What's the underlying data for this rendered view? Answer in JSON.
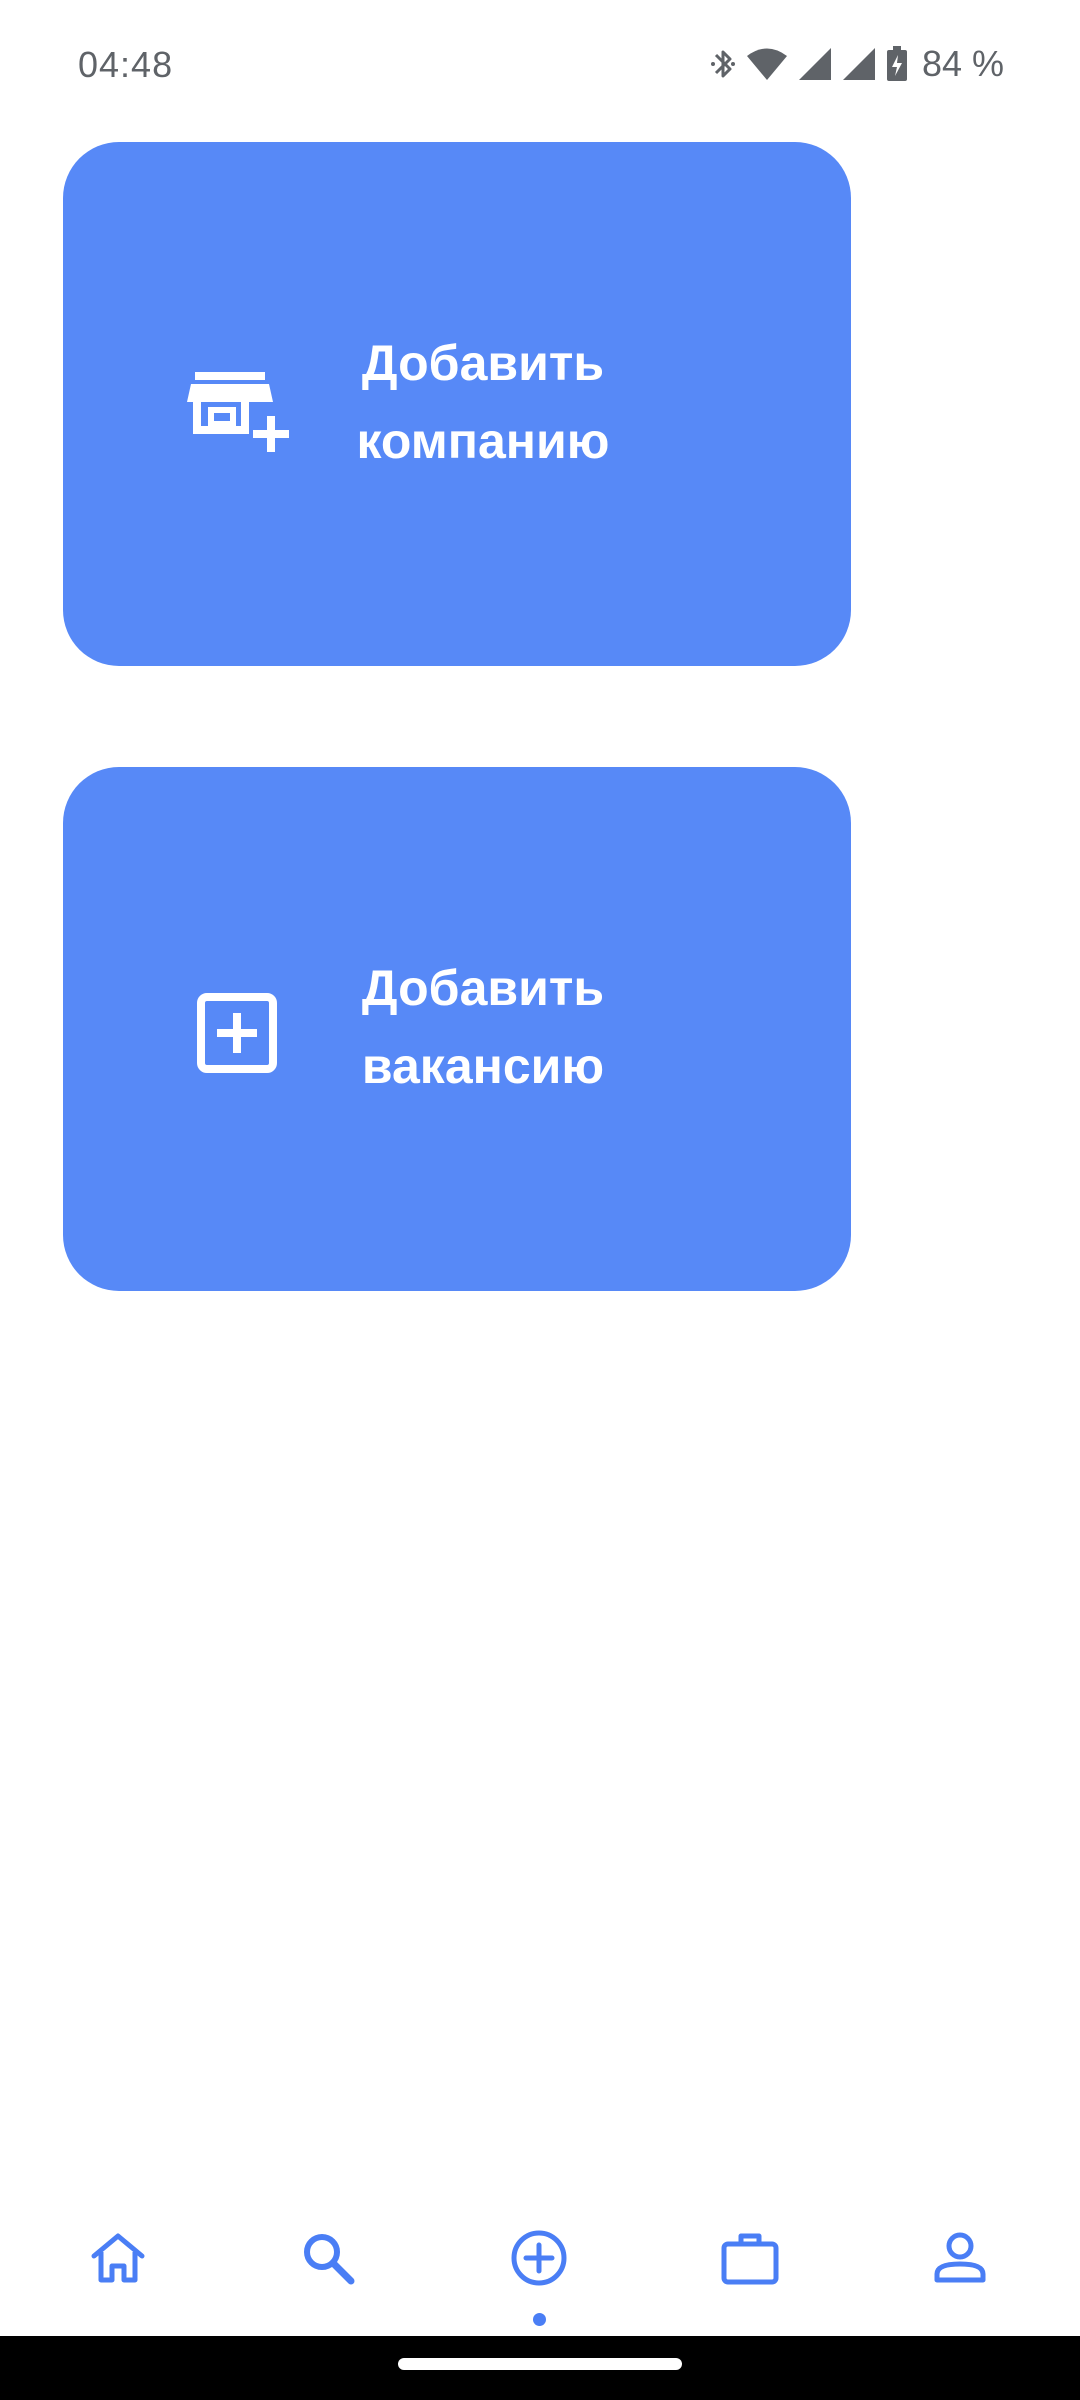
{
  "status_bar": {
    "time": "04:48",
    "battery": "84 %",
    "icons": [
      "bluetooth-icon",
      "wifi-icon",
      "signal-icon",
      "signal-icon",
      "battery-charging-icon"
    ]
  },
  "cards": {
    "company": {
      "icon": "add-store-icon",
      "label_line1": "Добавить",
      "label_line2": "компанию"
    },
    "vacancy": {
      "icon": "add-box-icon",
      "label_line1": "Добавить",
      "label_line2": "вакансию"
    }
  },
  "bottom_nav": {
    "items": [
      {
        "icon": "home-icon"
      },
      {
        "icon": "search-icon"
      },
      {
        "icon": "add-circle-icon",
        "selected": true
      },
      {
        "icon": "briefcase-icon"
      },
      {
        "icon": "person-icon"
      }
    ]
  },
  "colors": {
    "accent": "#5789f7",
    "nav_icon": "#4a7ef5",
    "status_text": "#5f6368",
    "background": "#ffffff"
  }
}
